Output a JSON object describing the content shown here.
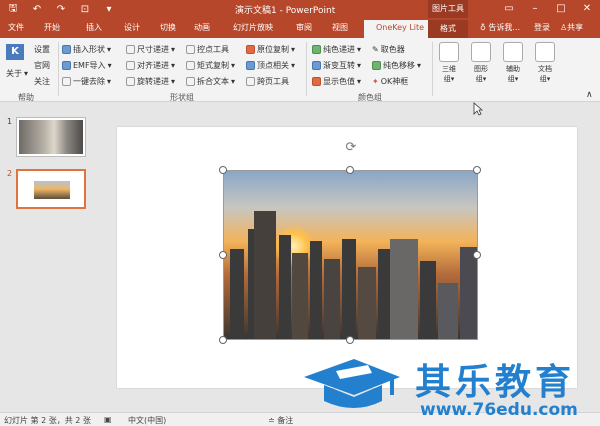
{
  "app": {
    "title": "演示文稿1 - PowerPoint",
    "picture_tools": "图片工具",
    "accent_color": "#b7472a"
  },
  "tabs": [
    "文件",
    "开始",
    "插入",
    "设计",
    "切换",
    "动画",
    "幻灯片放映",
    "审阅",
    "视图",
    "OneKey Lite",
    "格式"
  ],
  "tell_me": "告诉我...",
  "login": "登录",
  "share": "共享",
  "ribbon": {
    "help_group": {
      "about": "关于",
      "settings": "设置",
      "website": "官网",
      "follow": "关注",
      "label": "帮助"
    },
    "shape_group": {
      "insert_shape": "插入形状",
      "emf_import": "EMF导入",
      "one_click_remove": "一键去除",
      "size_increment": "尺寸递进",
      "align_increment": "对齐递进",
      "rotate_increment": "旋转递进",
      "control_tool": "控点工具",
      "matrix_copy": "矩式复制",
      "split_text": "拆合文本",
      "original_copy": "原位复制",
      "vertex_related": "顶点相关",
      "cross_page_tool": "跨页工具",
      "label": "形状组"
    },
    "color_group": {
      "solid_increment": "纯色递进",
      "gradient_swap": "渐变互转",
      "show_color": "显示色值",
      "eyedropper": "取色器",
      "solid_move": "纯色移移",
      "ok_magic": "OK神框",
      "label": "颜色组"
    },
    "big_buttons": [
      {
        "label": "三维",
        "sub": "组"
      },
      {
        "label": "图形",
        "sub": "组"
      },
      {
        "label": "辅助",
        "sub": "组"
      },
      {
        "label": "文档",
        "sub": "组"
      }
    ]
  },
  "slides": [
    "1",
    "2"
  ],
  "status": {
    "slide_info": "幻灯片 第 2 张，共 2 张",
    "language": "中文(中国)",
    "notes": "备注"
  },
  "watermark": {
    "title": "其乐教育",
    "url": "www.76edu.com"
  }
}
